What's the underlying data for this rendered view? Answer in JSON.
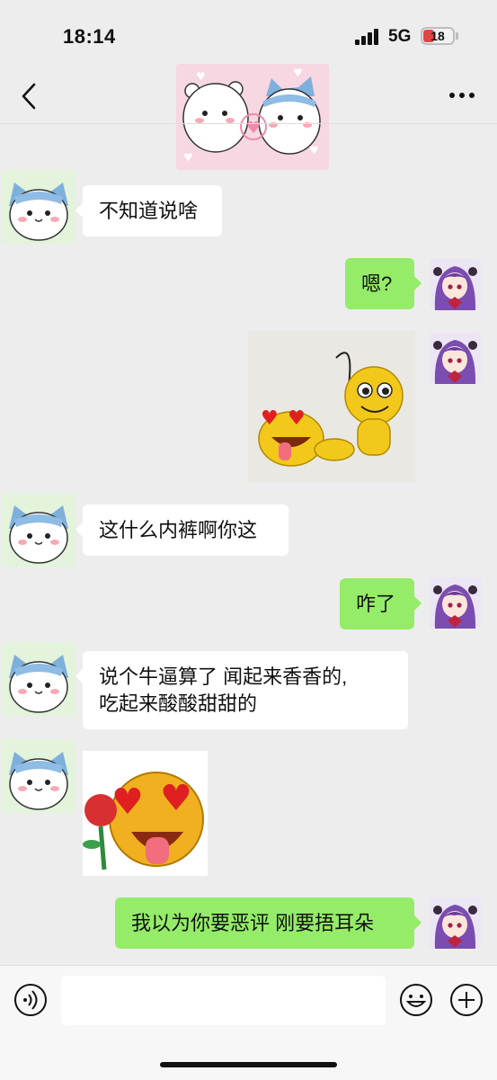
{
  "status_bar": {
    "time": "18:14",
    "network": "5G",
    "battery": "18"
  },
  "header": {
    "back_icon": "chevron-left-icon",
    "more_icon": "more-dots-icon"
  },
  "messages": [
    {
      "side": "left",
      "type": "text",
      "text": "不知道说啥"
    },
    {
      "side": "right",
      "type": "text",
      "text": "嗯?"
    },
    {
      "side": "right",
      "type": "sticker",
      "icon": "smiley-whip-sticker"
    },
    {
      "side": "left",
      "type": "text",
      "text": "这什么内裤啊你这"
    },
    {
      "side": "right",
      "type": "text",
      "text": "咋了"
    },
    {
      "side": "left",
      "type": "text",
      "lines": [
        "说个牛逼算了  闻起来香香的,",
        "吃起来酸酸甜甜的"
      ]
    },
    {
      "side": "left",
      "type": "sticker",
      "icon": "heart-eyes-rose-sticker"
    },
    {
      "side": "right",
      "type": "text",
      "text": "我以为你要恶评 刚要捂耳朵"
    }
  ],
  "input_bar": {
    "placeholder": ""
  },
  "colors": {
    "background": "#ededed",
    "bubble_right": "#95ec69",
    "bubble_left": "#ffffff"
  }
}
